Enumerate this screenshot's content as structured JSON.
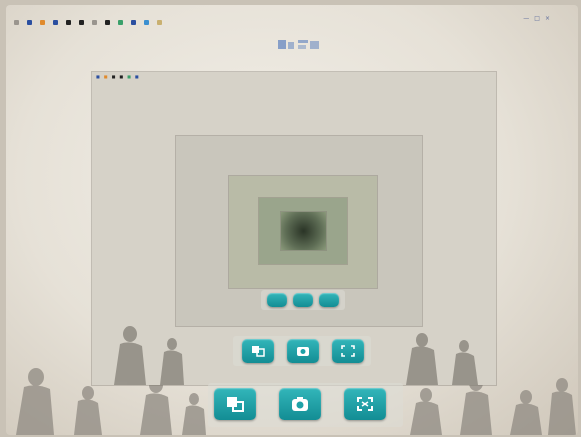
{
  "browser": {
    "bookmarks": [
      {
        "label": "",
        "color": "#9a958e"
      },
      {
        "label": "",
        "color": "#2b4fa0"
      },
      {
        "label": "",
        "color": "#e08a2c"
      },
      {
        "label": "",
        "color": "#2b4fa0"
      },
      {
        "label": "",
        "color": "#222222"
      },
      {
        "label": "",
        "color": "#222222"
      },
      {
        "label": "",
        "color": "#9a958e"
      },
      {
        "label": "",
        "color": "#222222"
      },
      {
        "label": "",
        "color": "#3aa06a"
      },
      {
        "label": "",
        "color": "#2b4fa0"
      },
      {
        "label": "",
        "color": "#3b8fd0"
      },
      {
        "label": "",
        "color": "#c9b070"
      }
    ],
    "window_controls": [
      "—",
      "□",
      "×"
    ]
  },
  "logo_text": "",
  "controls": [
    {
      "name": "switch-camera-button",
      "icon": "switch-camera-icon"
    },
    {
      "name": "snapshot-button",
      "icon": "camera-icon"
    },
    {
      "name": "fullscreen-button",
      "icon": "fullscreen-icon"
    }
  ],
  "colors": {
    "accent": "#1ea2a8",
    "accent_dark": "#138d94",
    "logo": "#3b69b8"
  }
}
